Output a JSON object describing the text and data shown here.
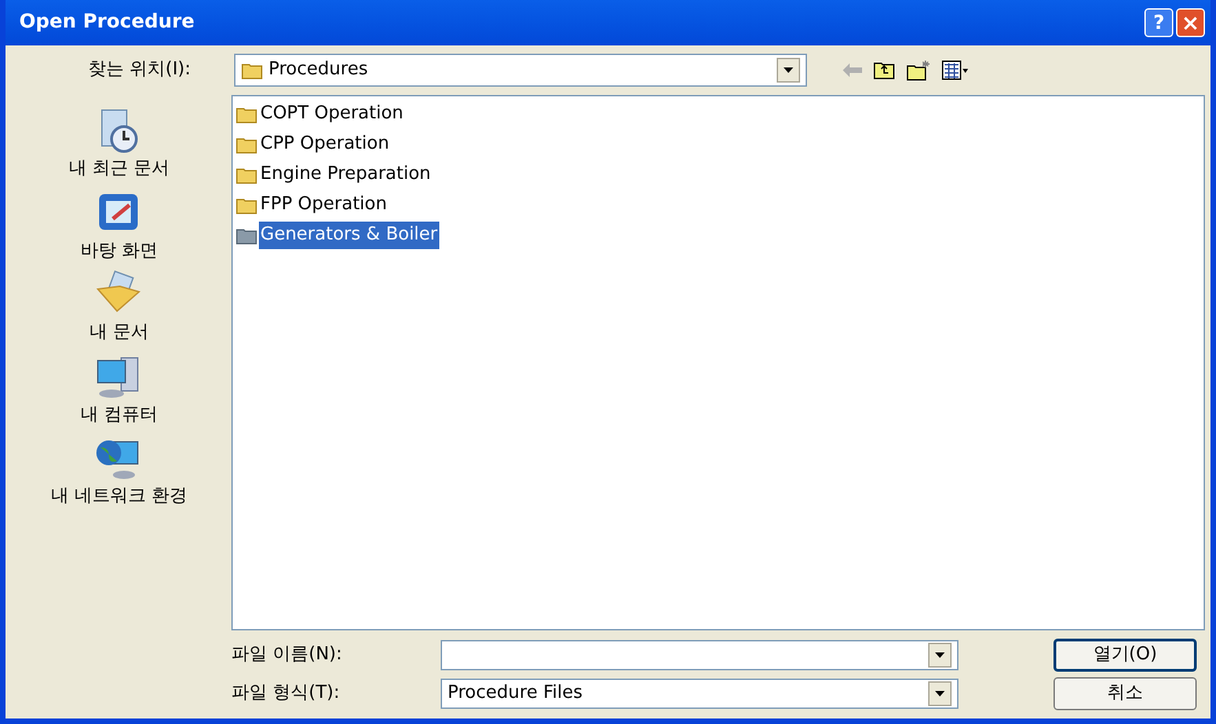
{
  "window": {
    "title": "Open Procedure",
    "help_button": "?",
    "close_button": "×"
  },
  "look_in": {
    "label": "찾는 위치(I):",
    "value": "Procedures"
  },
  "toolbar": [
    {
      "kind": "back",
      "disabled": true
    },
    {
      "kind": "up",
      "disabled": false
    },
    {
      "kind": "new-folder",
      "disabled": false
    },
    {
      "kind": "view",
      "disabled": false
    }
  ],
  "places": [
    {
      "kind": "recent",
      "label": "내 최근 문서"
    },
    {
      "kind": "desktop",
      "label": "바탕 화면"
    },
    {
      "kind": "documents",
      "label": "내 문서"
    },
    {
      "kind": "computer",
      "label": "내 컴퓨터"
    },
    {
      "kind": "network",
      "label": "내 네트워크 환경"
    }
  ],
  "files": [
    {
      "name": "COPT Operation",
      "selected": false
    },
    {
      "name": "CPP Operation",
      "selected": false
    },
    {
      "name": "Engine Preparation",
      "selected": false
    },
    {
      "name": "FPP Operation",
      "selected": false
    },
    {
      "name": "Generators & Boiler",
      "selected": true
    }
  ],
  "file_name": {
    "label": "파일 이름(N):"
  },
  "file_type": {
    "label": "파일 형식(T):",
    "value": "Procedure Files"
  },
  "buttons": [
    "열기(O)",
    "취소"
  ]
}
